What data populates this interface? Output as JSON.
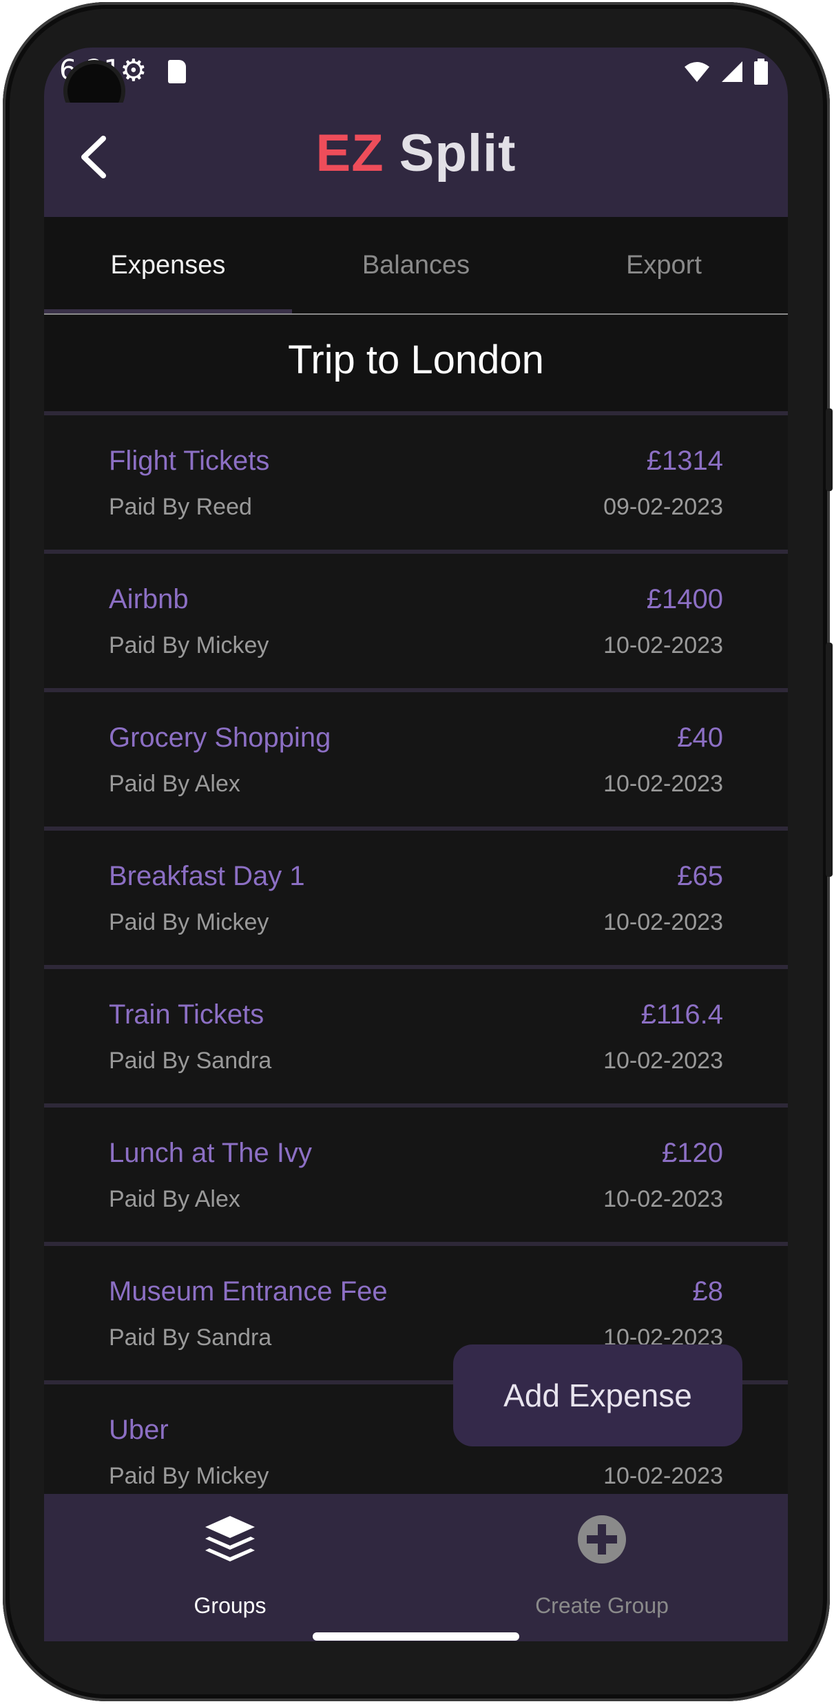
{
  "status_bar": {
    "time": "6:21"
  },
  "app_bar": {
    "title_accent": "EZ",
    "title_rest": "Split"
  },
  "tabs": [
    {
      "label": "Expenses",
      "active": true
    },
    {
      "label": "Balances",
      "active": false
    },
    {
      "label": "Export",
      "active": false
    }
  ],
  "group": {
    "title": "Trip to London"
  },
  "expenses": [
    {
      "name": "Flight Tickets",
      "amount": "£1314",
      "payer": "Paid By Reed",
      "date": "09-02-2023"
    },
    {
      "name": "Airbnb",
      "amount": "£1400",
      "payer": "Paid By Mickey",
      "date": "10-02-2023"
    },
    {
      "name": "Grocery Shopping",
      "amount": "£40",
      "payer": "Paid By Alex",
      "date": "10-02-2023"
    },
    {
      "name": "Breakfast Day 1",
      "amount": "£65",
      "payer": "Paid By Mickey",
      "date": "10-02-2023"
    },
    {
      "name": "Train Tickets",
      "amount": "£116.4",
      "payer": "Paid By Sandra",
      "date": "10-02-2023"
    },
    {
      "name": "Lunch at The Ivy",
      "amount": "£120",
      "payer": "Paid By Alex",
      "date": "10-02-2023"
    },
    {
      "name": "Museum Entrance Fee",
      "amount": "£8",
      "payer": "Paid By Sandra",
      "date": "10-02-2023"
    },
    {
      "name": "Uber",
      "amount": "",
      "payer": "Paid By Mickey",
      "date": "10-02-2023"
    }
  ],
  "fab": {
    "label": "Add Expense"
  },
  "bottom_nav": [
    {
      "label": "Groups",
      "icon": "layers-icon",
      "active": true
    },
    {
      "label": "Create Group",
      "icon": "plus-circle-icon",
      "active": false
    }
  ],
  "colors": {
    "bar": "#302840",
    "accent": "#8c6fc4",
    "title_accent": "#ee4d5a",
    "background": "#121212"
  }
}
